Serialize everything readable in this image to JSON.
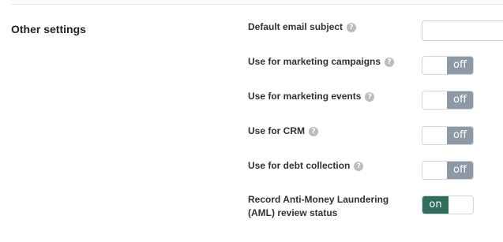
{
  "section": {
    "title": "Other settings"
  },
  "help_glyph": "?",
  "settings": [
    {
      "label": "Default email subject",
      "type": "text",
      "value": "",
      "placeholder": ""
    },
    {
      "label": "Use for marketing campaigns",
      "type": "toggle",
      "state": "off"
    },
    {
      "label": "Use for marketing events",
      "type": "toggle",
      "state": "off"
    },
    {
      "label": "Use for CRM",
      "type": "toggle",
      "state": "off"
    },
    {
      "label": "Use for debt collection",
      "type": "toggle",
      "state": "off"
    },
    {
      "label_line1": "Record Anti-Money Laundering",
      "label_line2": "(AML) review status",
      "type": "toggle",
      "state": "on"
    }
  ],
  "colors": {
    "toggle_off": "#8d9aa5",
    "toggle_on": "#2f6e5c",
    "help_icon": "#b9bcc0"
  }
}
